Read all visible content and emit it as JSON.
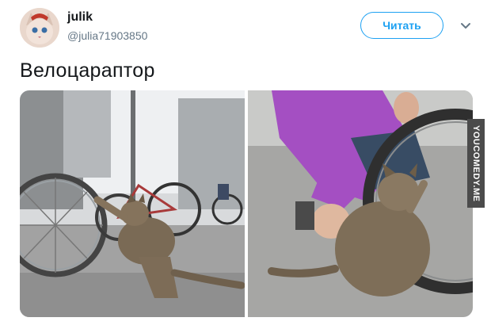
{
  "user": {
    "name": "julik",
    "handle": "@julia71903850"
  },
  "follow_button": {
    "label": "Читать"
  },
  "tweet": {
    "text": "Велоцараптор"
  },
  "watermark": {
    "text": "YOUCOMEDY.ME"
  },
  "colors": {
    "accent": "#1da1f2",
    "secondary_text": "#657786",
    "primary_text": "#14171a"
  },
  "icons": {
    "more": "chevron-down-icon"
  }
}
